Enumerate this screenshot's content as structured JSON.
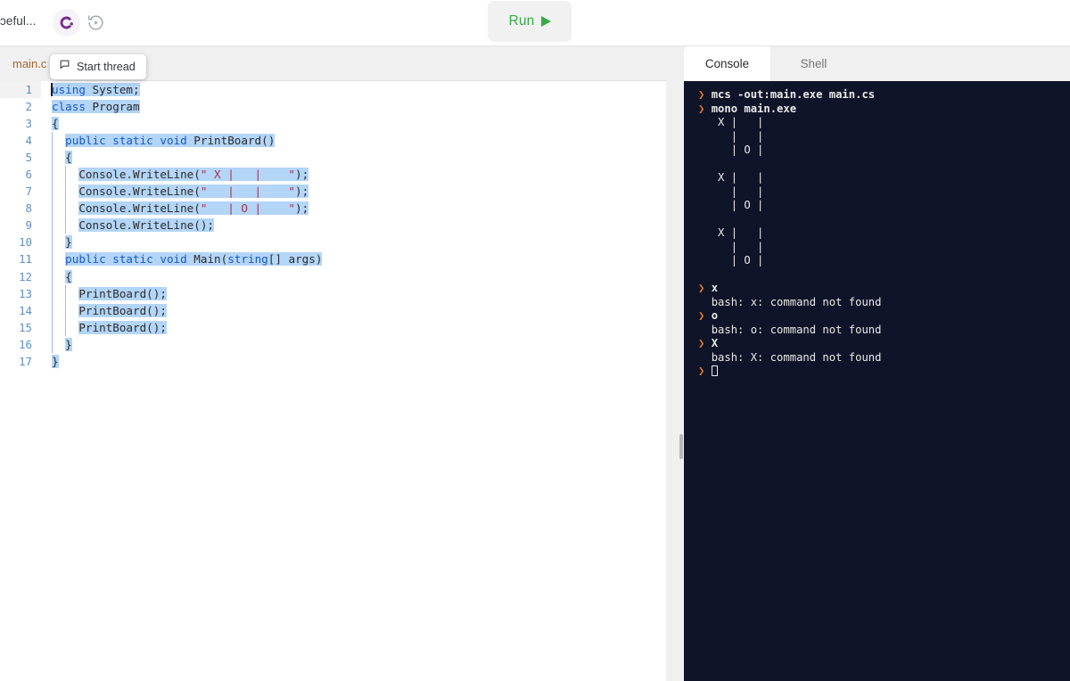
{
  "topbar": {
    "project_name": "ɔeful...",
    "lang_icon": "csharp-logo-icon",
    "history_icon": "history-revert-icon",
    "run_label": "Run",
    "run_icon": "play-triangle-icon"
  },
  "editor": {
    "file_tab_label": "main.c",
    "thread_tooltip": {
      "icon": "comment-bubble-icon",
      "label": "Start thread"
    },
    "line_numbers": [
      "1",
      "2",
      "3",
      "4",
      "5",
      "6",
      "7",
      "8",
      "9",
      "10",
      "11",
      "12",
      "13",
      "14",
      "15",
      "16",
      "17"
    ],
    "code_lines": [
      "using System;",
      "class Program",
      "{",
      "  public static void PrintBoard()",
      "  {",
      "    Console.WriteLine(\" X |   |    \");",
      "    Console.WriteLine(\"   |   |    \");",
      "    Console.WriteLine(\"   | O |    \");",
      "    Console.WriteLine();",
      "  }",
      "  public static void Main(string[] args)",
      "  {",
      "    PrintBoard();",
      "    PrintBoard();",
      "    PrintBoard();",
      "  }",
      "}"
    ]
  },
  "console": {
    "tabs": [
      {
        "label": "Console",
        "active": true
      },
      {
        "label": "Shell",
        "active": false
      }
    ],
    "prompt_symbol": "❯",
    "output_lines": [
      {
        "type": "cmd",
        "text": "mcs -out:main.exe main.cs"
      },
      {
        "type": "cmd",
        "text": "mono main.exe"
      },
      {
        "type": "out",
        "text": " X |   |    "
      },
      {
        "type": "out",
        "text": "   |   |    "
      },
      {
        "type": "out",
        "text": "   | O |    "
      },
      {
        "type": "out",
        "text": ""
      },
      {
        "type": "out",
        "text": " X |   |    "
      },
      {
        "type": "out",
        "text": "   |   |    "
      },
      {
        "type": "out",
        "text": "   | O |    "
      },
      {
        "type": "out",
        "text": ""
      },
      {
        "type": "out",
        "text": " X |   |    "
      },
      {
        "type": "out",
        "text": "   |   |    "
      },
      {
        "type": "out",
        "text": "   | O |    "
      },
      {
        "type": "out",
        "text": ""
      },
      {
        "type": "cmd",
        "text": "x"
      },
      {
        "type": "out",
        "text": "bash: x: command not found"
      },
      {
        "type": "cmd",
        "text": "o"
      },
      {
        "type": "out",
        "text": "bash: o: command not found"
      },
      {
        "type": "cmd",
        "text": "X"
      },
      {
        "type": "out",
        "text": "bash: X: command not found"
      },
      {
        "type": "cursor",
        "text": ""
      }
    ]
  },
  "colors": {
    "accent_run": "#37a94a",
    "prompt_orange": "#e8762b",
    "console_bg": "#101428",
    "selection_blue": "#b3d5f7",
    "keyword_blue": "#1758c9",
    "string_red": "#a8324a",
    "linenum_blue": "#5c8fc4",
    "filetab_orange": "#a9632c"
  }
}
